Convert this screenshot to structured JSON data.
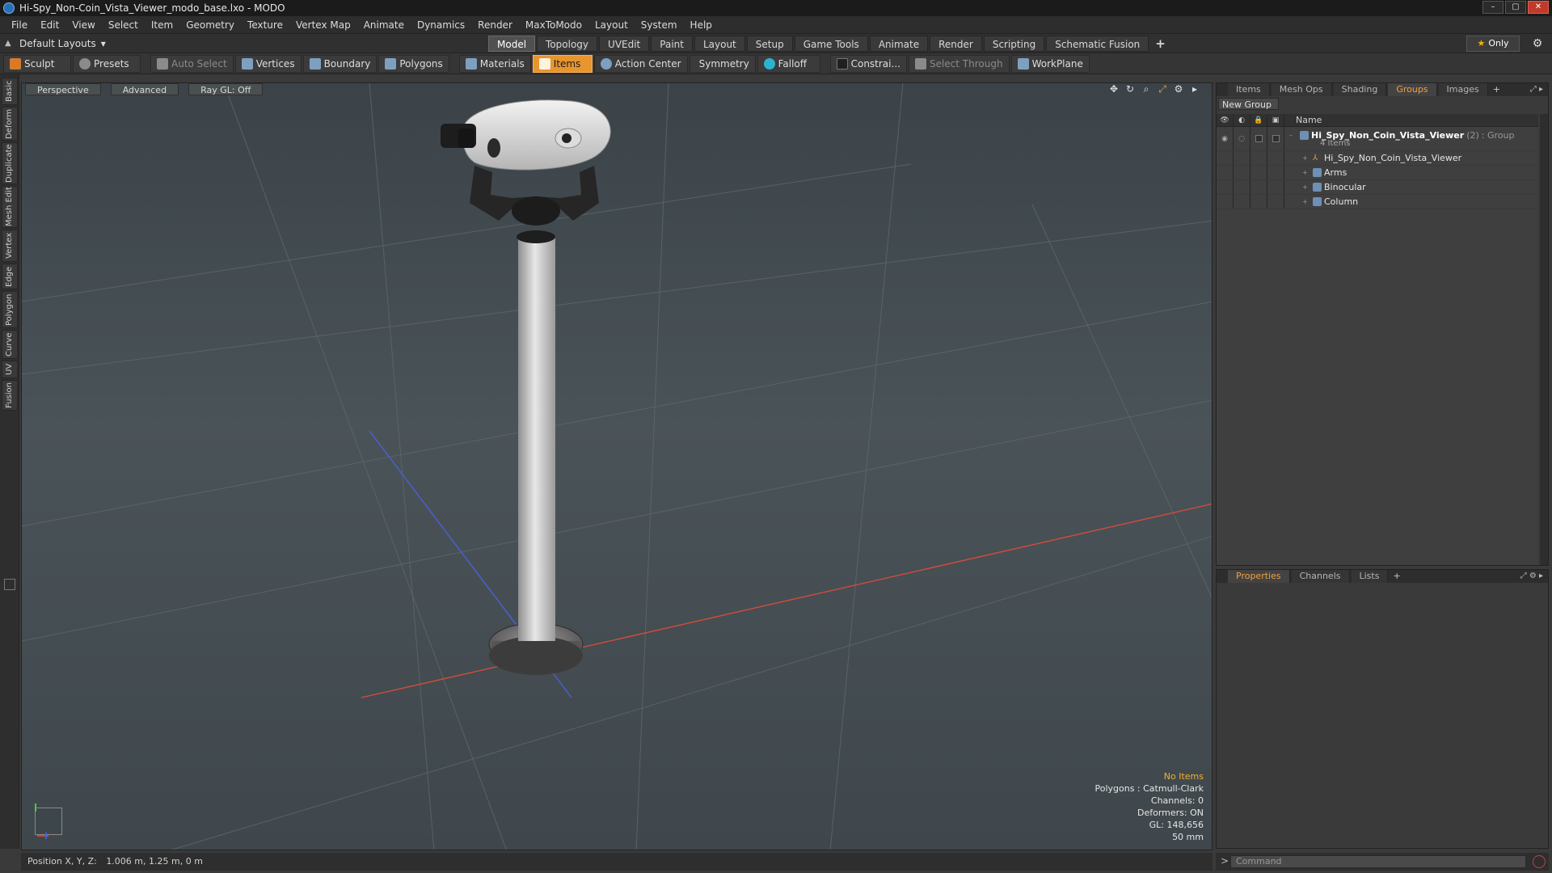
{
  "window": {
    "title": "Hi-Spy_Non-Coin_Vista_Viewer_modo_base.lxo - MODO",
    "buttons": [
      "–",
      "▢",
      "✕"
    ]
  },
  "menu": [
    "File",
    "Edit",
    "View",
    "Select",
    "Item",
    "Geometry",
    "Texture",
    "Vertex Map",
    "Animate",
    "Dynamics",
    "Render",
    "MaxToModo",
    "Layout",
    "System",
    "Help"
  ],
  "layoutbar": {
    "preset": "Default Layouts",
    "tabs": [
      "Model",
      "Topology",
      "UVEdit",
      "Paint",
      "Layout",
      "Setup",
      "Game Tools",
      "Animate",
      "Render",
      "Scripting",
      "Schematic Fusion"
    ],
    "active_tab": "Model",
    "only_label": "Only"
  },
  "toolbar": {
    "sculpt": "Sculpt",
    "presets": "Presets",
    "auto_select": "Auto Select",
    "vertices": "Vertices",
    "boundary": "Boundary",
    "polygons": "Polygons",
    "materials": "Materials",
    "items": "Items",
    "action_center": "Action Center",
    "symmetry": "Symmetry",
    "falloff": "Falloff",
    "constraints": "Constrai...",
    "select_through": "Select Through",
    "workplane": "WorkPlane"
  },
  "left_tabs": [
    "Basic",
    "Deform",
    "Duplicate",
    "Mesh Edit",
    "Vertex",
    "Edge",
    "Polygon",
    "Curve",
    "UV",
    "Fusion"
  ],
  "viewport": {
    "view": "Perspective",
    "shading": "Advanced",
    "raygl": "Ray GL: Off",
    "info": {
      "selection": "No Items",
      "polygons": "Polygons : Catmull-Clark",
      "channels": "Channels: 0",
      "deformers": "Deformers: ON",
      "gl": "GL: 148,656",
      "focal": "50 mm"
    }
  },
  "status": {
    "label": "Position X, Y, Z:",
    "value": "1.006 m, 1.25 m, 0 m"
  },
  "groups_panel": {
    "tabs": [
      "Items",
      "Mesh Ops",
      "Shading",
      "Groups",
      "Images"
    ],
    "active_tab": "Groups",
    "new_group": "New Group",
    "name_header": "Name",
    "group": {
      "name": "Hi_Spy_Non_Coin_Vista_Viewer",
      "count": "(2)",
      "type": ": Group",
      "sub": "4 Items"
    },
    "children": [
      "Hi_Spy_Non_Coin_Vista_Viewer",
      "Arms",
      "Binocular",
      "Column"
    ]
  },
  "properties_panel": {
    "tabs": [
      "Properties",
      "Channels",
      "Lists"
    ],
    "active_tab": "Properties"
  },
  "command": {
    "placeholder": "Command"
  },
  "colors": {
    "accent": "#e8952e",
    "active_tab_text": "#f0a040",
    "warn_text": "#f0b030"
  }
}
